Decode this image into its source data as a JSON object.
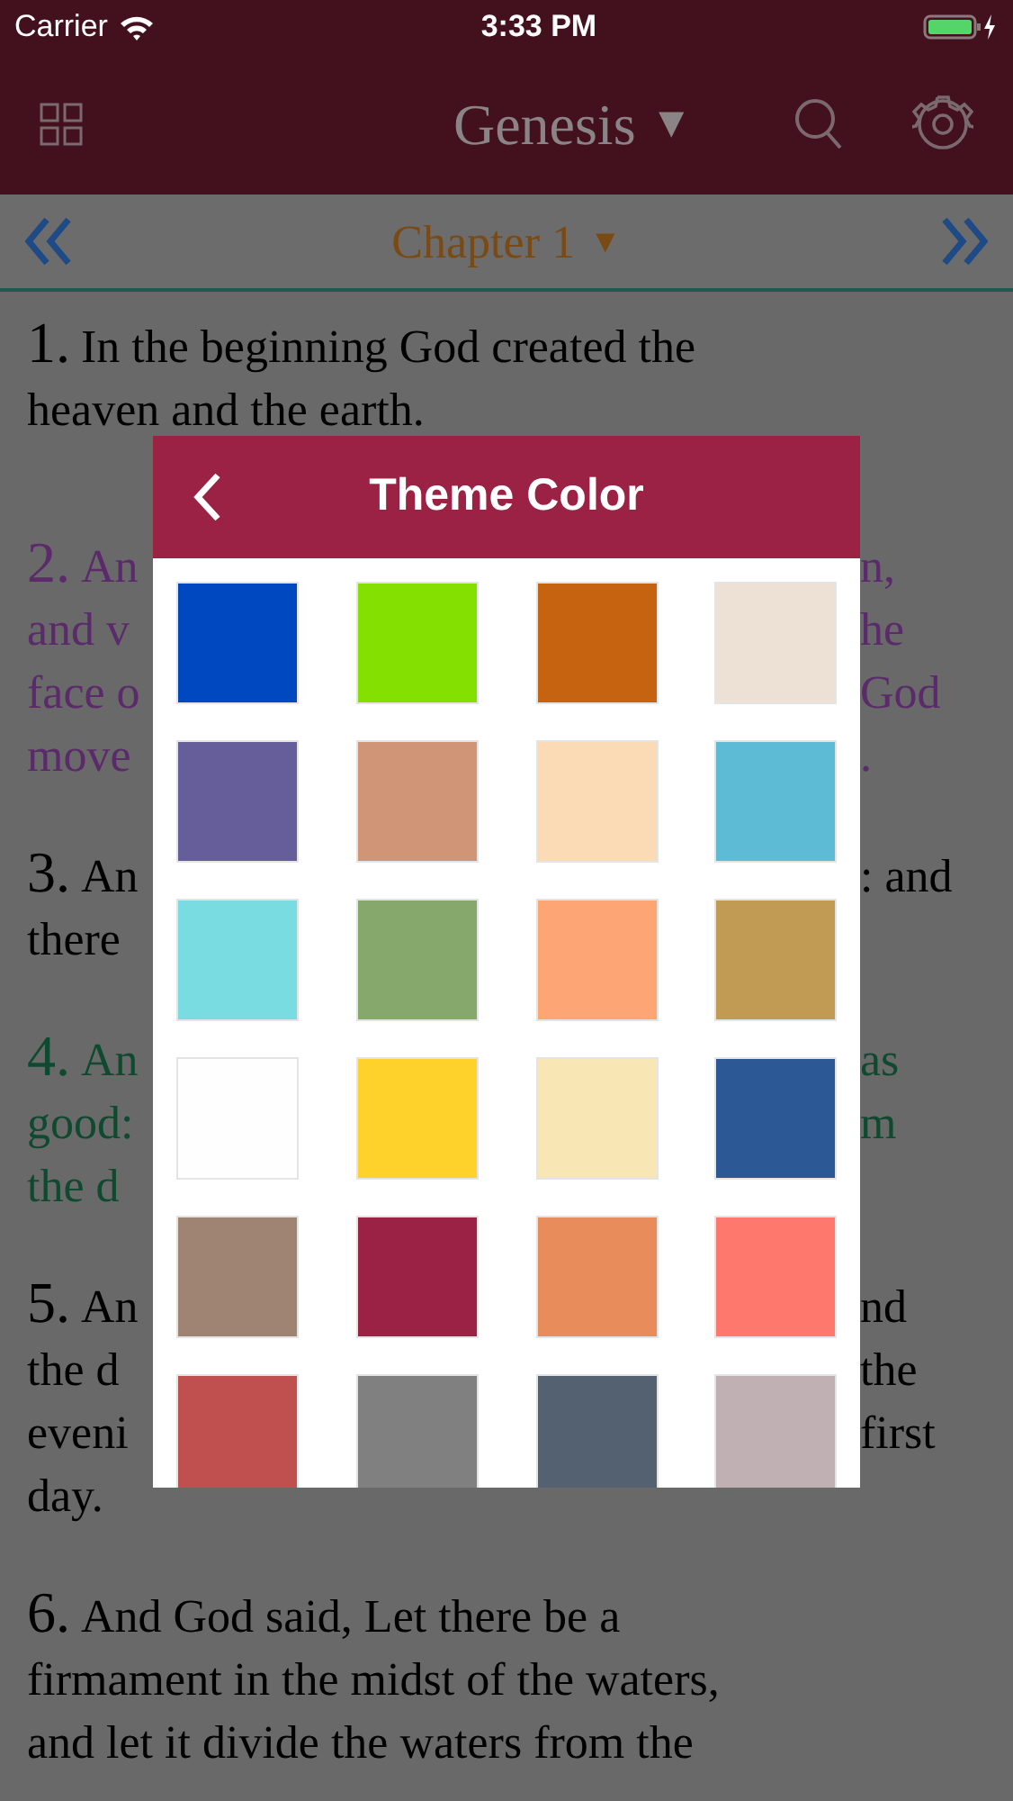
{
  "status_bar": {
    "carrier": "Carrier",
    "time": "3:33 PM"
  },
  "nav_bar": {
    "title": "Genesis",
    "caret": "▼"
  },
  "chapter_bar": {
    "label": "Chapter 1",
    "caret": "▼"
  },
  "verses": [
    {
      "number": "1.",
      "color": "#000000",
      "lines": [
        {
          "left": "In the beginning God created the"
        },
        {
          "left": "heaven and the earth."
        }
      ]
    },
    {
      "number": "2.",
      "color": "#5b2a6b",
      "lines": [
        {
          "left": "An",
          "right": "n,"
        },
        {
          "left": "and v",
          "right": "he"
        },
        {
          "left": "face o",
          "right": "God"
        },
        {
          "left": "move",
          "right": "."
        }
      ]
    },
    {
      "number": "3.",
      "color": "#000000",
      "lines": [
        {
          "left": "An",
          "right": ": and"
        },
        {
          "left": "there"
        }
      ]
    },
    {
      "number": "4.",
      "color": "#0f4a30",
      "lines": [
        {
          "left": "An",
          "right": "as"
        },
        {
          "left": "good:",
          "right": "m"
        },
        {
          "left": "the d"
        }
      ]
    },
    {
      "number": "5.",
      "color": "#000000",
      "lines": [
        {
          "left": "An",
          "right": "nd"
        },
        {
          "left": "the d",
          "right": "the"
        },
        {
          "left": "eveni",
          "right": "first"
        },
        {
          "left": "day."
        }
      ]
    },
    {
      "number": "6.",
      "color": "#000000",
      "lines": [
        {
          "left": "And God said, Let there be a"
        },
        {
          "left": "firmament in the midst of the waters,"
        },
        {
          "left": "and let it divide the waters from the"
        }
      ]
    }
  ],
  "dialog": {
    "title": "Theme Color",
    "swatches": [
      {
        "color": "#0048c0"
      },
      {
        "color": "#84e000"
      },
      {
        "color": "#c66310"
      },
      {
        "color": "#ede0d4"
      },
      {
        "color": "#655e9b"
      },
      {
        "color": "#cf9576"
      },
      {
        "color": "#fbdab6"
      },
      {
        "color": "#5ebbd6"
      },
      {
        "color": "#79dce0"
      },
      {
        "color": "#87a86d"
      },
      {
        "color": "#fea575"
      },
      {
        "color": "#c19a53"
      },
      {
        "color": "#fefefe"
      },
      {
        "color": "#ffd22b"
      },
      {
        "color": "#f8e6b5"
      },
      {
        "color": "#2d5896"
      },
      {
        "color": "#a08473"
      },
      {
        "color": "#9b2244"
      },
      {
        "color": "#e88c5c"
      },
      {
        "color": "#ff786d"
      },
      {
        "color": "#c05050"
      },
      {
        "color": "#808080"
      },
      {
        "color": "#546170"
      },
      {
        "color": "#c0b0b4"
      }
    ]
  }
}
